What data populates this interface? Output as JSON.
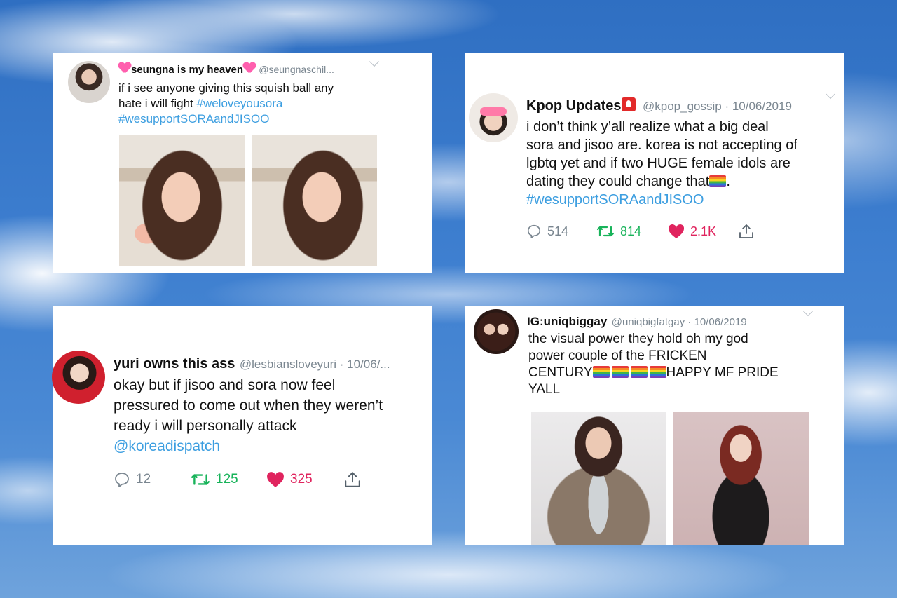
{
  "tweets": [
    {
      "name": "seungna is my heaven",
      "handle": "@seungnaschil...",
      "text_1": "if i see anyone giving this squish ball any",
      "text_2": "hate i will fight ",
      "hashtag_1": "#weloveyousora",
      "hashtag_2": "#wesupportSORAandJISOO",
      "icons": [
        "sparkling-heart-icon",
        "avatar-photo",
        "chevron-down-icon"
      ]
    },
    {
      "name": "Kpop Updates",
      "handle": "@kpop_gossip · 10/06/2019",
      "text_lines": [
        "i don’t think y’all realize what a big deal",
        "sora and jisoo are. korea is not accepting of",
        "lgbtq yet and if two HUGE female idols are",
        "dating they could change that"
      ],
      "text_end": ".",
      "hashtag": "#wesupportSORAandJISOO",
      "replies": "514",
      "retweets": "814",
      "likes": "2.1K"
    },
    {
      "name": "yuri owns this ass",
      "handle": "@lesbiansloveyuri · 10/06/...",
      "text_lines": [
        "okay but if jisoo and sora now feel",
        "pressured to come out when they weren’t",
        "ready i will personally attack"
      ],
      "mention": "@koreadispatch",
      "replies": "12",
      "retweets": "125",
      "likes": "325"
    },
    {
      "name": "IG:uniqbiggay",
      "handle": "@uniqbigfatgay · 10/06/2019",
      "text_1": "the visual power they hold oh my god",
      "text_2": "power couple of the FRICKEN",
      "text_3a": "CENTURY",
      "text_3b": "HAPPY MF PRIDE",
      "text_4": "YALL"
    }
  ],
  "colors": {
    "hashtag": "#3c9ee0",
    "retweet": "#18b35a",
    "like": "#e0245e",
    "muted": "#7a8690"
  }
}
